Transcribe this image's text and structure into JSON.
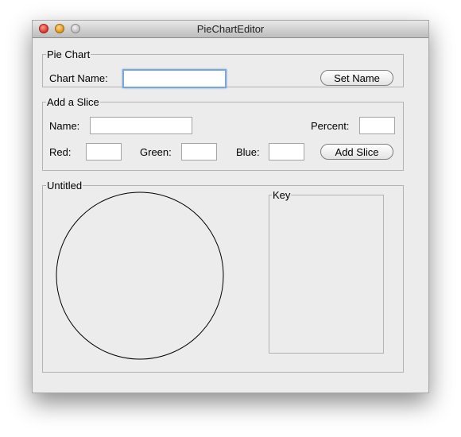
{
  "window": {
    "title": "PieChartEditor"
  },
  "pie_chart_group": {
    "legend": "Pie Chart",
    "chart_name_label": "Chart Name:",
    "chart_name_value": "",
    "set_name_button": "Set Name"
  },
  "slice_group": {
    "legend": "Add a Slice",
    "name_label": "Name:",
    "name_value": "",
    "percent_label": "Percent:",
    "percent_value": "",
    "red_label": "Red:",
    "red_value": "",
    "green_label": "Green:",
    "green_value": "",
    "blue_label": "Blue:",
    "blue_value": "",
    "add_slice_button": "Add Slice"
  },
  "chart_group": {
    "legend": "Untitled",
    "key_legend": "Key"
  }
}
